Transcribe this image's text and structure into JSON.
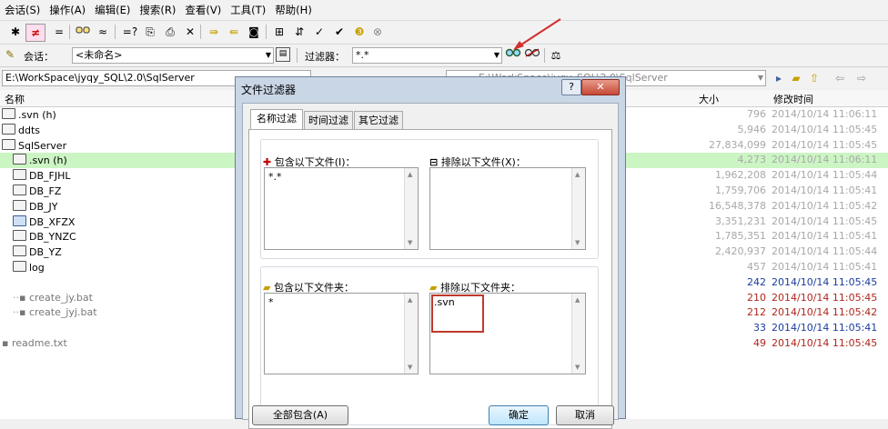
{
  "menu": [
    "会话(S)",
    "操作(A)",
    "编辑(E)",
    "搜索(R)",
    "查看(V)",
    "工具(T)",
    "帮助(H)"
  ],
  "session": {
    "label": "会话：",
    "value": "<未命名>"
  },
  "filter": {
    "label": "过滤器：",
    "value": "*.*"
  },
  "path": {
    "left": "E:\\WorkSpace\\jyqy_SQL\\2.0\\SqlServer",
    "right_fragment": "E:\\WorkSpace\\jyqy_SQL\\2.0\\SqlServer"
  },
  "columns": {
    "name": "名称",
    "size": "大小",
    "modified": "修改时间"
  },
  "rows": [
    {
      "name": ".svn  (h)",
      "size": "796",
      "date": "2014/10/14 11:06:11",
      "kind": "folder",
      "indent": 0,
      "hl": false,
      "gray": true
    },
    {
      "name": "ddts",
      "size": "5,946",
      "date": "2014/10/14 11:05:45",
      "kind": "folder",
      "indent": 0,
      "hl": false,
      "gray": true
    },
    {
      "name": "SqlServer",
      "size": "27,834,099",
      "date": "2014/10/14 11:05:45",
      "kind": "folder-open",
      "indent": 0,
      "hl": false,
      "gray": true
    },
    {
      "name": ".svn  (h)",
      "size": "4,273",
      "date": "2014/10/14 11:06:11",
      "kind": "folder",
      "indent": 1,
      "hl": true,
      "gray": true
    },
    {
      "name": "DB_FJHL",
      "size": "1,962,208",
      "date": "2014/10/14 11:05:44",
      "kind": "folder",
      "indent": 1,
      "hl": false,
      "gray": true
    },
    {
      "name": "DB_FZ",
      "size": "1,759,706",
      "date": "2014/10/14 11:05:41",
      "kind": "folder",
      "indent": 1,
      "hl": false,
      "gray": true
    },
    {
      "name": "DB_JY",
      "size": "16,548,378",
      "date": "2014/10/14 11:05:42",
      "kind": "folder",
      "indent": 1,
      "hl": false,
      "gray": true
    },
    {
      "name": "DB_XFZX",
      "size": "3,351,231",
      "date": "2014/10/14 11:05:45",
      "kind": "folder-blue",
      "indent": 1,
      "hl": false,
      "gray": true
    },
    {
      "name": "DB_YNZC",
      "size": "1,785,351",
      "date": "2014/10/14 11:05:41",
      "kind": "folder",
      "indent": 1,
      "hl": false,
      "gray": true
    },
    {
      "name": "DB_YZ",
      "size": "2,420,937",
      "date": "2014/10/14 11:05:44",
      "kind": "folder",
      "indent": 1,
      "hl": false,
      "gray": true
    },
    {
      "name": "log",
      "size": "457",
      "date": "2014/10/14 11:05:41",
      "kind": "folder",
      "indent": 1,
      "hl": false,
      "gray": true
    },
    {
      "name": "",
      "size": "242",
      "date": "2014/10/14 11:05:45",
      "kind": "none",
      "indent": 1,
      "hl": false,
      "gray": false,
      "color": "#1a3c9e"
    },
    {
      "name": "create_jy.bat",
      "size": "210",
      "date": "2014/10/14 11:05:45",
      "kind": "file",
      "indent": 1,
      "hl": false,
      "gray": true,
      "color": "#b0261c"
    },
    {
      "name": "create_jyj.bat",
      "size": "212",
      "date": "2014/10/14 11:05:42",
      "kind": "file",
      "indent": 1,
      "hl": false,
      "gray": true,
      "color": "#b0261c"
    },
    {
      "name": "",
      "size": "33",
      "date": "2014/10/14 11:05:41",
      "kind": "none",
      "indent": 0,
      "hl": false,
      "gray": false,
      "color": "#1a3c9e"
    },
    {
      "name": "readme.txt",
      "size": "49",
      "date": "2014/10/14 11:05:45",
      "kind": "file",
      "indent": 0,
      "hl": false,
      "gray": true,
      "color": "#b0261c"
    }
  ],
  "dialog": {
    "title": "文件过滤器",
    "help": "?",
    "tabs": [
      "名称过滤",
      "时间过滤",
      "其它过滤"
    ],
    "include_files": {
      "label": "包含以下文件(I)：",
      "items": [
        "*.*"
      ]
    },
    "exclude_files": {
      "label": "排除以下文件(X)：",
      "items": []
    },
    "include_folders": {
      "label": "包含以下文件夹：",
      "items": [
        "*"
      ]
    },
    "exclude_folders": {
      "label": "排除以下文件夹：",
      "items": [
        ".svn"
      ]
    },
    "btn_include_all": "全部包含(A)",
    "btn_ok": "确定",
    "btn_cancel": "取消"
  },
  "colors": {
    "highlight_row": "#ccf5c4",
    "annotation_red": "#d32f2f",
    "dialog_frame": "#c9d6e6"
  }
}
